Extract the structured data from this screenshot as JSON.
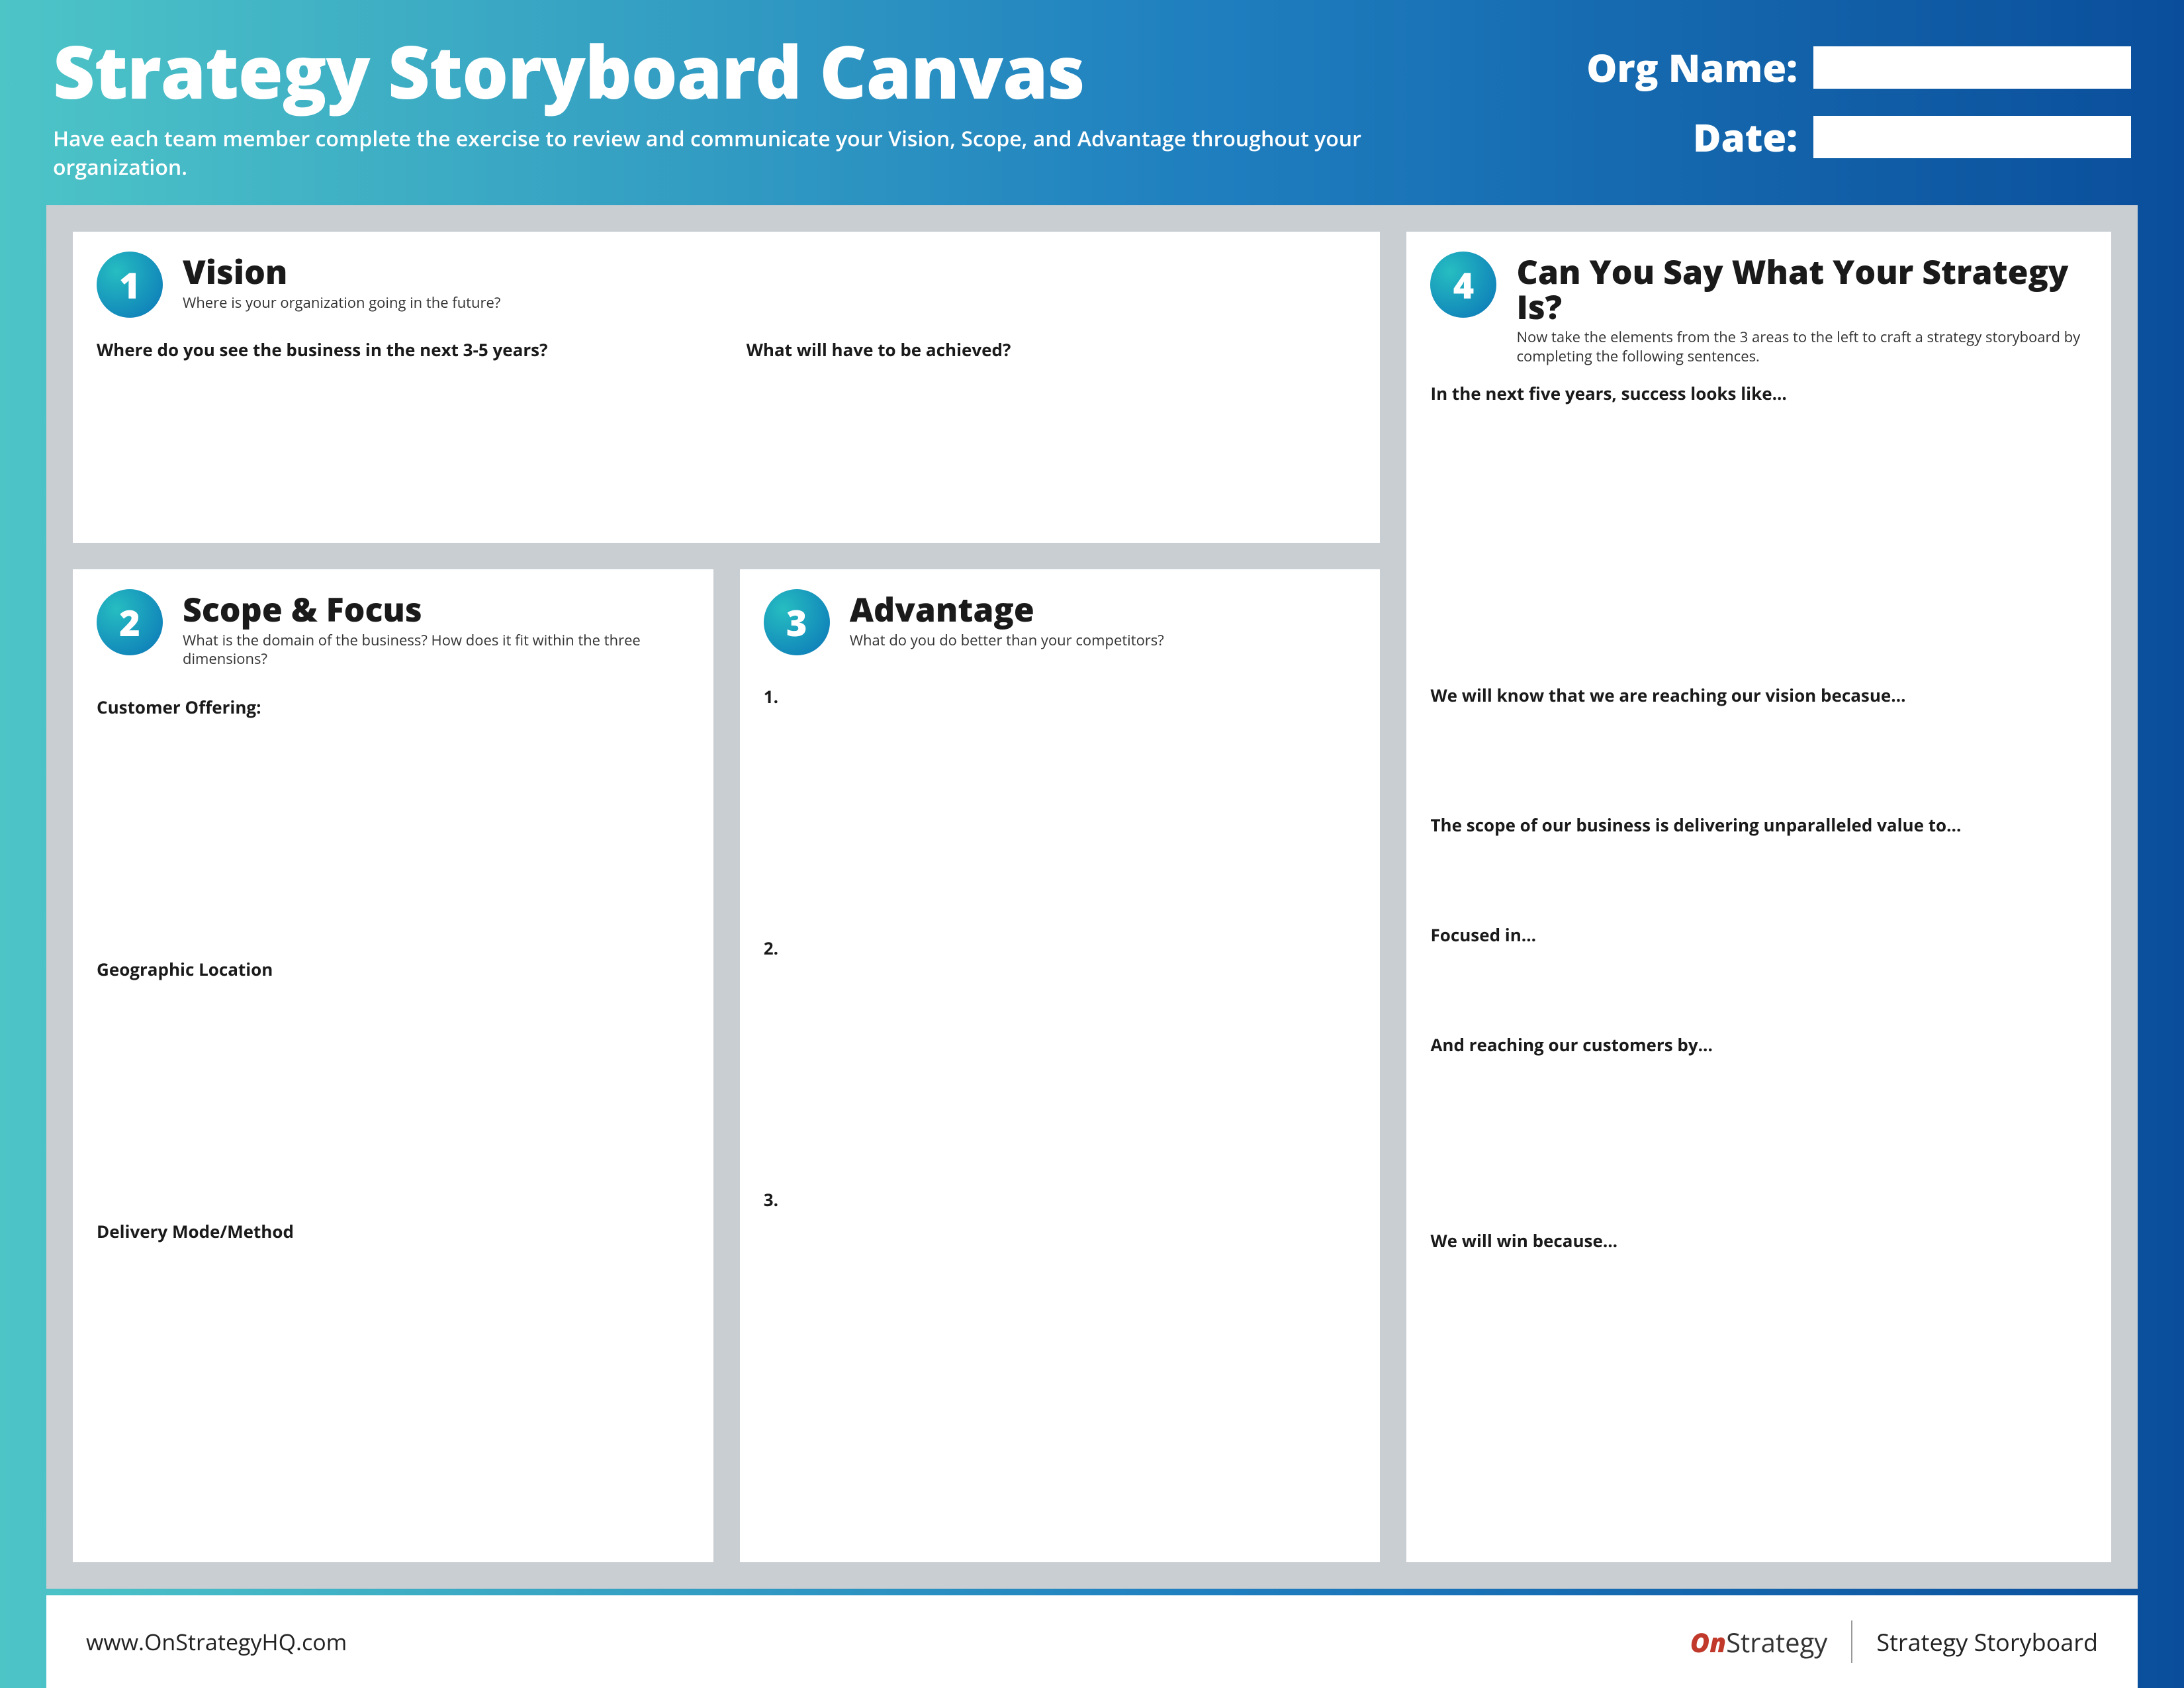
{
  "header": {
    "title": "Strategy Storyboard Canvas",
    "subtitle": "Have each team member complete the exercise to review and communicate your Vision, Scope, and Advantage throughout your organization.",
    "org_label": "Org Name:",
    "date_label": "Date:",
    "org_value": "",
    "date_value": ""
  },
  "vision": {
    "badge": "1",
    "title": "Vision",
    "subtitle": "Where is your organization going in the future?",
    "q1": "Where do you see the business in the next 3-5 years?",
    "q2": "What will have to be achieved?"
  },
  "scope": {
    "badge": "2",
    "title": "Scope & Focus",
    "subtitle": "What is the domain of the business? How does it fit within the three dimensions?",
    "p1": "Customer Offering:",
    "p2": "Geographic Location",
    "p3": "Delivery Mode/Method"
  },
  "advantage": {
    "badge": "3",
    "title": "Advantage",
    "subtitle": "What do you do better than your competitors?",
    "i1": "1.",
    "i2": "2.",
    "i3": "3."
  },
  "strategy": {
    "badge": "4",
    "title": "Can You Say What Your Strategy Is?",
    "subtitle": "Now take the elements from the 3 areas to the left to craft a strategy storyboard by completing the following sentences.",
    "p1": "In the next five years, success looks like...",
    "p2": "We will know that we are reaching our vision becasue...",
    "p3": "The scope of our business is delivering unparalleled value to...",
    "p4": "Focused in...",
    "p5": "And reaching our customers by...",
    "p6": "We will win because..."
  },
  "footer": {
    "url": "www.OnStrategyHQ.com",
    "logo_on": "On",
    "logo_rest": "Strategy",
    "doc_name": "Strategy Storyboard"
  }
}
